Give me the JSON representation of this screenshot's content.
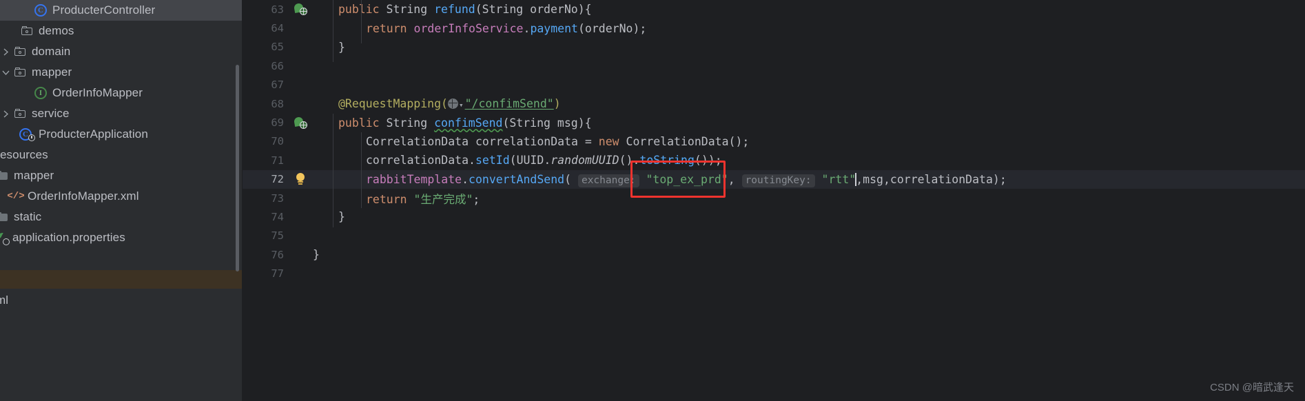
{
  "sidebar": {
    "items": [
      {
        "label": "ProducterController",
        "icon": "class-icon",
        "state": "selected-focus",
        "arrow": "none",
        "indent": 3
      },
      {
        "label": "demos",
        "icon": "folder-module-icon",
        "state": "none",
        "arrow": "none",
        "indent": 1
      },
      {
        "label": "domain",
        "icon": "folder-module-icon",
        "state": "none",
        "arrow": "collapsed",
        "indent": 1
      },
      {
        "label": "mapper",
        "icon": "folder-module-icon",
        "state": "none",
        "arrow": "expanded",
        "indent": 1
      },
      {
        "label": "OrderInfoMapper",
        "icon": "interface-icon",
        "state": "none",
        "arrow": "none",
        "indent": 2
      },
      {
        "label": "service",
        "icon": "folder-module-icon",
        "state": "none",
        "arrow": "collapsed",
        "indent": 1
      },
      {
        "label": "ProducterApplication",
        "icon": "class-run-icon",
        "state": "none",
        "arrow": "none",
        "indent": 1
      },
      {
        "label": "esources",
        "icon": "none",
        "state": "none",
        "arrow": "none",
        "indent": 0
      },
      {
        "label": "mapper",
        "icon": "folder-plain-icon",
        "state": "none",
        "arrow": "none",
        "indent": 0
      },
      {
        "label": "OrderInfoMapper.xml",
        "icon": "xml-icon",
        "state": "none",
        "arrow": "none",
        "indent": 1
      },
      {
        "label": "static",
        "icon": "folder-plain-icon",
        "state": "none",
        "arrow": "none",
        "indent": 0
      },
      {
        "label": "application.properties",
        "icon": "properties-icon",
        "state": "none",
        "arrow": "none",
        "indent": 0
      },
      {
        "label": "",
        "icon": "none",
        "state": "none",
        "arrow": "none",
        "indent": 0
      },
      {
        "label": "",
        "icon": "none",
        "state": "selected-unfocus",
        "arrow": "none",
        "indent": 0
      },
      {
        "label": "ml",
        "icon": "none",
        "state": "none",
        "arrow": "none",
        "indent": 0
      }
    ]
  },
  "editor": {
    "lines": [
      {
        "num": "63",
        "marker": "override-web-icon",
        "current": false
      },
      {
        "num": "64",
        "marker": "none",
        "current": false
      },
      {
        "num": "65",
        "marker": "none",
        "current": false
      },
      {
        "num": "66",
        "marker": "none",
        "current": false
      },
      {
        "num": "67",
        "marker": "none",
        "current": false
      },
      {
        "num": "68",
        "marker": "none",
        "current": false
      },
      {
        "num": "69",
        "marker": "override-web-icon",
        "current": false
      },
      {
        "num": "70",
        "marker": "none",
        "current": false
      },
      {
        "num": "71",
        "marker": "none",
        "current": false
      },
      {
        "num": "72",
        "marker": "bulb-icon",
        "current": true
      },
      {
        "num": "73",
        "marker": "none",
        "current": false
      },
      {
        "num": "74",
        "marker": "none",
        "current": false
      },
      {
        "num": "75",
        "marker": "none",
        "current": false
      },
      {
        "num": "76",
        "marker": "none",
        "current": false
      },
      {
        "num": "77",
        "marker": "none",
        "current": false
      }
    ],
    "code": {
      "l63": {
        "kw1": "public",
        "t1": " ",
        "type1": "String",
        "t2": " ",
        "m1": "refund",
        "t3": "(",
        "type2": "String",
        "t4": " orderNo){"
      },
      "l64": {
        "kw1": "return",
        "t1": " ",
        "f1": "orderInfoService",
        "t2": ".",
        "m1": "payment",
        "t3": "(orderNo);"
      },
      "l65": {
        "t1": "}"
      },
      "l66": {
        "t1": ""
      },
      "l67": {
        "t1": ""
      },
      "l68": {
        "ann": "@RequestMapping",
        "p1": "(",
        "str": "\"/confimSend\"",
        "p2": ")"
      },
      "l69": {
        "kw1": "public",
        "t1": " ",
        "type1": "String",
        "t2": " ",
        "m1": "confimSend",
        "t3": "(",
        "type2": "String",
        "t4": " msg){"
      },
      "l70": {
        "type1": "CorrelationData",
        "t1": " correlationData = ",
        "kw1": "new",
        "t2": " ",
        "type2": "CorrelationData",
        "t3": "();"
      },
      "l71": {
        "t1": "correlationData.",
        "m1": "setId",
        "t2": "(",
        "type1": "UUID",
        "t3": ".",
        "stat1": "randomUUID",
        "t4": "().",
        "m2": "toString",
        "t5": "());"
      },
      "l72": {
        "f1": "rabbitTemplate",
        "t1": ".",
        "m1": "convertAndSend",
        "t2": "( ",
        "hint1": "exchange:",
        "str1": "\"top_ex_prd\"",
        "t3": ", ",
        "hint2": "routingKey:",
        "str2": "\"rtt\"",
        "t4": ",msg,correlationData);"
      },
      "l73": {
        "kw1": "return",
        "t1": " ",
        "str1": "\"生产完成\"",
        "t2": ";"
      },
      "l74": {
        "t1": "}"
      },
      "l75": {
        "t1": ""
      },
      "l76": {
        "t1": "}"
      },
      "l77": {
        "t1": ""
      }
    }
  },
  "annotation": {
    "red_box_target": "\"top_ex_prd\"",
    "red_box_color": "#f0332e"
  },
  "watermark": {
    "text": "CSDN @暗武逢天"
  }
}
